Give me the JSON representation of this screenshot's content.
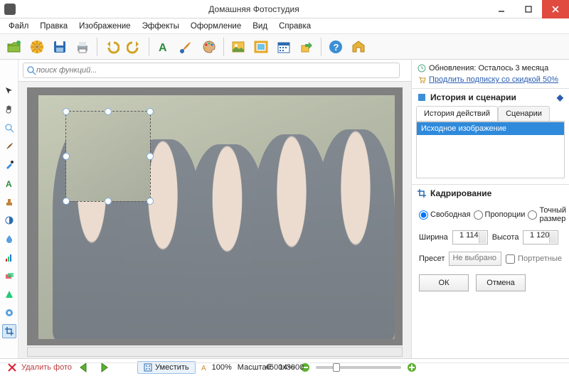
{
  "window": {
    "title": "Домашняя Фотостудия"
  },
  "menu": [
    "Файл",
    "Правка",
    "Изображение",
    "Эффекты",
    "Оформление",
    "Вид",
    "Справка"
  ],
  "search": {
    "placeholder": "поиск функций..."
  },
  "updates": {
    "line1": "Обновления: Осталось  3 месяца",
    "line2_link": "Продлить подписку со скидкой 50%"
  },
  "history_panel": {
    "title": "История и сценарии",
    "tab_history": "История действий",
    "tab_scenarios": "Сценарии",
    "items": [
      "Исходное изображение"
    ]
  },
  "crop_panel": {
    "title": "Кадрирование",
    "mode_free": "Свободная",
    "mode_prop": "Пропорции",
    "mode_exact": "Точный размер",
    "width_label": "Ширина",
    "height_label": "Высота",
    "width_value": "1 114",
    "height_value": "1 120",
    "preset_label": "Пресет",
    "preset_value": "Не выбрано",
    "portrait_label": "Портретные",
    "ok": "ОК",
    "cancel": "Отмена"
  },
  "status": {
    "delete": "Удалить фото",
    "fit": "Уместить",
    "zoom_100": "100%",
    "scale_label": "Масштаб:",
    "scale_value": "14%",
    "dimensions": "4500x3000"
  }
}
